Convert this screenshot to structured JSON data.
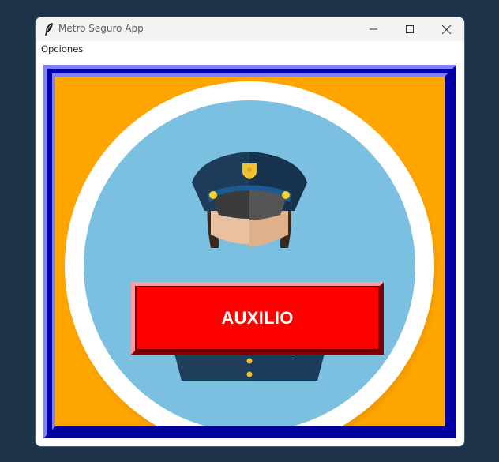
{
  "window": {
    "title": "Metro Seguro App",
    "controls": {
      "minimize_icon": "minimize-icon",
      "maximize_icon": "maximize-icon",
      "close_icon": "close-icon"
    }
  },
  "menubar": {
    "items": [
      {
        "label": "Opciones"
      }
    ]
  },
  "main": {
    "illustration": "police-officer-illustration",
    "help_button_label": "AUXILIO"
  },
  "colors": {
    "desktop_background": "#1c3349",
    "frame_light": "#8080ff",
    "frame_dark": "#000099",
    "panel_background": "#ffa500",
    "circle_fill": "#7bbfe1",
    "button_red": "#ff0000"
  }
}
